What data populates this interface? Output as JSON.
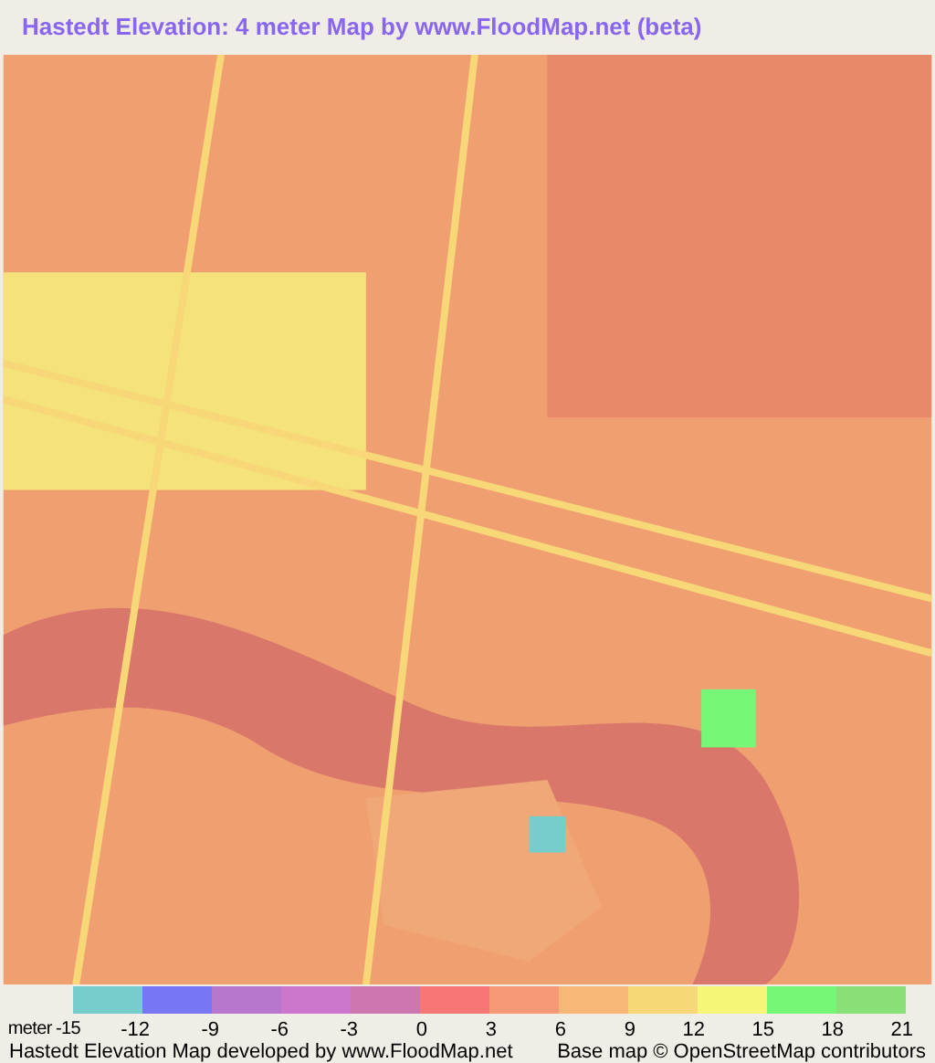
{
  "title": "Hastedt Elevation: 4 meter Map by www.FloodMap.net (beta)",
  "legend": {
    "unit": "meter",
    "swatches": [
      {
        "color": "#77cccc"
      },
      {
        "color": "#7777f5"
      },
      {
        "color": "#b777cc"
      },
      {
        "color": "#cc77cc"
      },
      {
        "color": "#cc77b0"
      },
      {
        "color": "#f77777"
      },
      {
        "color": "#f79977"
      },
      {
        "color": "#f7b777"
      },
      {
        "color": "#f7d777"
      },
      {
        "color": "#f5f577"
      },
      {
        "color": "#77f777"
      },
      {
        "color": "#88e077"
      }
    ],
    "ticks": [
      "-15",
      "-12",
      "-9",
      "-6",
      "-3",
      "0",
      "3",
      "6",
      "9",
      "12",
      "15",
      "18",
      "21"
    ]
  },
  "footer": {
    "left": "Hastedt Elevation Map developed by www.FloodMap.net",
    "right": "Base map © OpenStreetMap contributors"
  }
}
